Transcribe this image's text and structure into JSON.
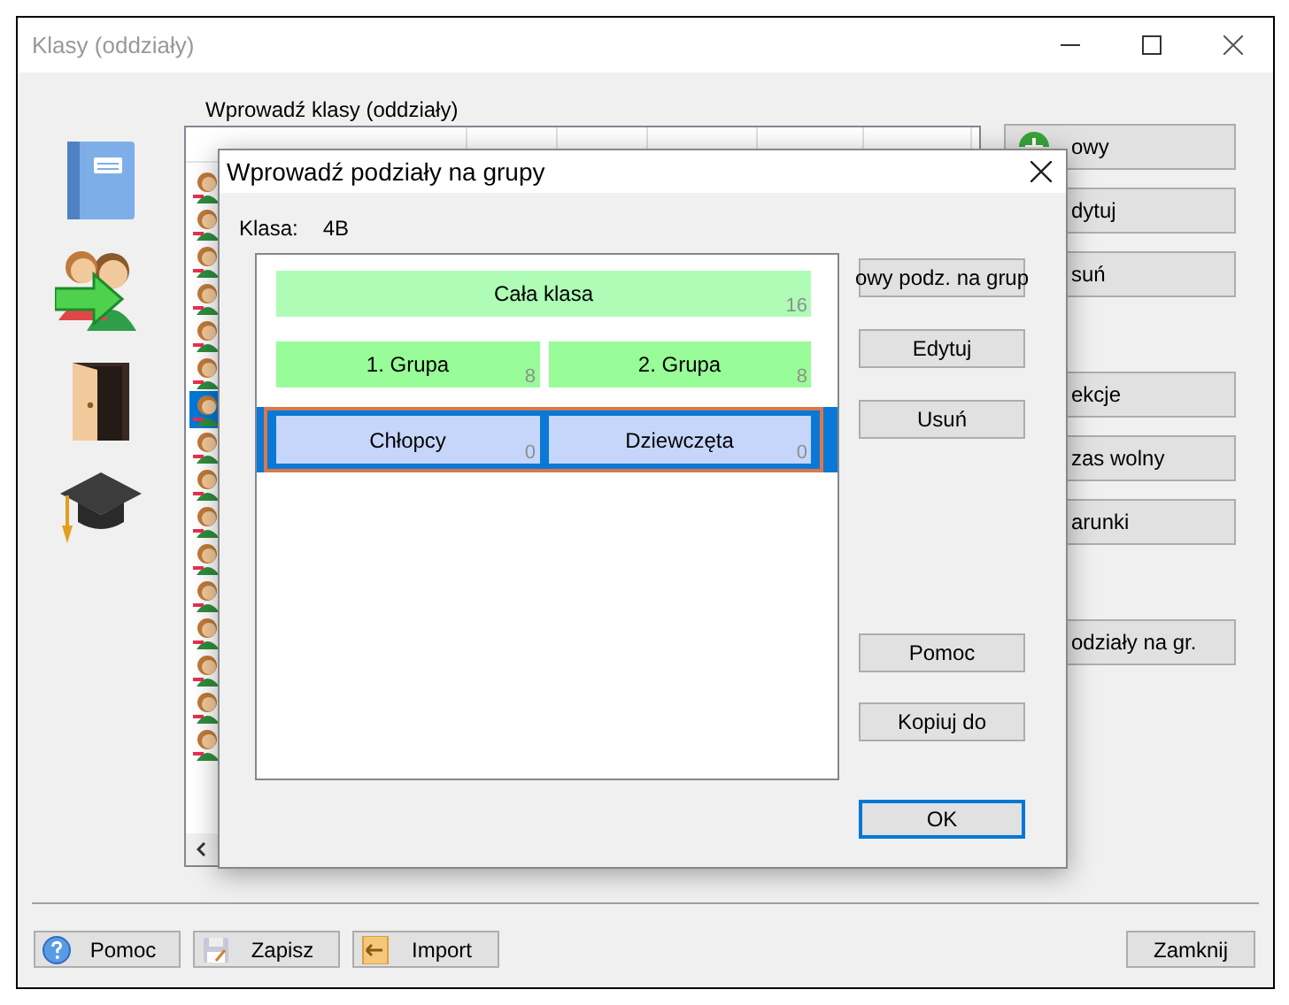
{
  "window": {
    "title": "Klasy (oddziały)"
  },
  "sidebar": {
    "items": [
      {
        "kind": "book"
      },
      {
        "kind": "people"
      },
      {
        "kind": "door"
      },
      {
        "kind": "cap"
      }
    ]
  },
  "list": {
    "label": "Wprowadź klasy (oddziały)",
    "rows": [
      {
        "selected": false
      },
      {
        "selected": false
      },
      {
        "selected": false
      },
      {
        "selected": false
      },
      {
        "selected": false
      },
      {
        "selected": false
      },
      {
        "selected": true
      },
      {
        "selected": false
      },
      {
        "selected": false
      },
      {
        "selected": false
      },
      {
        "selected": false
      },
      {
        "selected": false
      },
      {
        "selected": false
      },
      {
        "selected": false
      },
      {
        "selected": false
      },
      {
        "selected": false
      }
    ]
  },
  "side_button_groups": [
    [
      {
        "label": "owy",
        "kind": "add"
      },
      {
        "label": "dytuj",
        "kind": "plain"
      },
      {
        "label": "suń",
        "kind": "plain"
      }
    ],
    [
      {
        "label": "ekcje",
        "kind": "plain"
      },
      {
        "label": "zas wolny",
        "kind": "plain"
      },
      {
        "label": "arunki",
        "kind": "plain"
      }
    ],
    [
      {
        "label": "odziały na gr.",
        "kind": "plain"
      }
    ]
  ],
  "bottom_buttons": [
    {
      "label": "Pomoc",
      "kind": "help"
    },
    {
      "label": "Zapisz",
      "kind": "save"
    },
    {
      "label": "Import",
      "kind": "import"
    }
  ],
  "close_button": {
    "label": "Zamknij"
  },
  "dialog": {
    "title": "Wprowadź podziały na grupy",
    "class_label": "Klasa:",
    "class_value": "4B",
    "divisions": [
      {
        "selected": false,
        "color": "#aefcb6",
        "groups": [
          {
            "name": "Cała klasa",
            "count": "16"
          }
        ]
      },
      {
        "selected": false,
        "color": "#98fc98",
        "groups": [
          {
            "name": "1. Grupa",
            "count": "8"
          },
          {
            "name": "2. Grupa",
            "count": "8"
          }
        ]
      },
      {
        "selected": true,
        "color": "#c6d6fb",
        "groups": [
          {
            "name": "Chłopcy",
            "count": "0"
          },
          {
            "name": "Dziewczęta",
            "count": "0"
          }
        ]
      }
    ],
    "actions": [
      {
        "label": "owy podz. na grup"
      },
      {
        "label": "Edytuj"
      },
      {
        "label": "Usuń"
      }
    ],
    "tools": [
      {
        "label": "Pomoc"
      },
      {
        "label": "Kopiuj do"
      }
    ],
    "ok": {
      "label": "OK",
      "default": true
    }
  }
}
